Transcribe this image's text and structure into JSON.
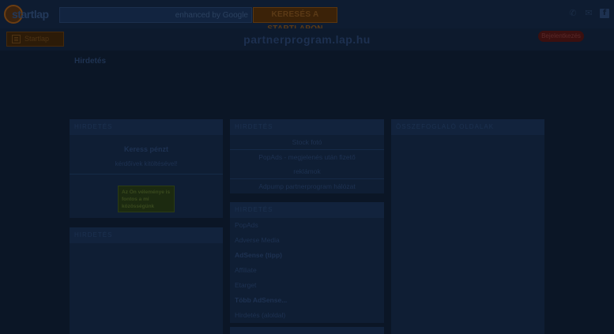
{
  "header": {
    "logo_text": "startlap",
    "search_placeholder": "enhanced by Google",
    "search_button": "KERESÉS A STARTLAPON",
    "menu_label": "Startlap"
  },
  "site": {
    "title": "partnerprogram.lap.hu",
    "login_badge": "Bejelentkezés"
  },
  "breadcrumb": "Hirdetés",
  "panels": {
    "p1": {
      "title": "HIRDETÉS",
      "line1": "Keress pénzt",
      "line2": "kérdőívek kitöltésével!",
      "ad_text": "Az Ön véleménye is fontos a mi közösségünk"
    },
    "p2": {
      "title": "HIRDETÉS"
    },
    "p3": {
      "title": "HIRDETÉS",
      "rows": [
        "Stock fotó",
        "PopAds - megjelenés után fizető",
        "reklámok",
        "Adpump partnerprogram hálózat"
      ]
    },
    "p4": {
      "title": "HIRDETÉS",
      "items": [
        "PopAds",
        "Adverse Media",
        "AdSense (tipp)",
        "Affiliate",
        "Etarget",
        "Több AdSense...",
        "Hirdetés (aloldal)"
      ]
    },
    "p6": {
      "title": "ÖSSZEFOGLALÓ OLDALAK"
    }
  }
}
